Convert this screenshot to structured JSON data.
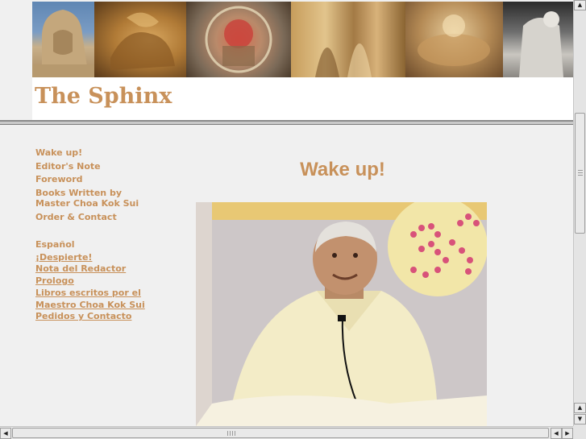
{
  "site": {
    "title": "The Sphinx"
  },
  "nav": {
    "english": [
      "Wake up!",
      "Editor's Note",
      "Foreword",
      "Books Written by",
      "Master Choa Kok Sui",
      "Order & Contact"
    ],
    "spanish_heading": "Español",
    "spanish": [
      "¡Despierte!",
      "Nota del Redactor",
      "Prologo",
      "Libros escritos por el",
      "Maestro Choa Kok Sui",
      "Pedidos y Contacto"
    ]
  },
  "main": {
    "heading": "Wake up!"
  },
  "colors": {
    "accent": "#c8915a",
    "background": "#f0f0f0"
  },
  "icons": {
    "scroll_up": "▲",
    "scroll_down": "▼",
    "scroll_left": "◀",
    "scroll_right": "▶"
  }
}
